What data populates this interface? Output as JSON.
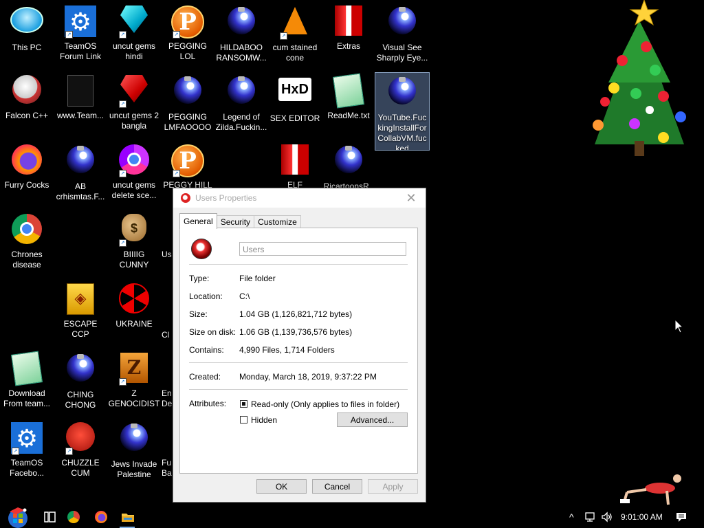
{
  "desktop": {
    "icons": [
      {
        "label": "This PC"
      },
      {
        "label": "TeamOS Forum Link"
      },
      {
        "label": "uncut gems hindi"
      },
      {
        "label": "PEGGING LOL"
      },
      {
        "label": "HILDABOO RANSOMW..."
      },
      {
        "label": "cum stained cone"
      },
      {
        "label": "Extras"
      },
      {
        "label": "Visual See Sharply Eye..."
      },
      {
        "label": "Falcon C++"
      },
      {
        "label": "www.Team..."
      },
      {
        "label": "uncut gems 2 bangla"
      },
      {
        "label": "PEGGING LMFAOOOO"
      },
      {
        "label": "Legend of Zilda.Fuckin..."
      },
      {
        "label": "SEX EDITOR"
      },
      {
        "label": "ReadMe.txt"
      },
      {
        "label": "YouTube.FuckingInstallForCollabVM.fucked"
      },
      {
        "label": "Furry Cocks"
      },
      {
        "label": "AB crhismtas.F..."
      },
      {
        "label": "uncut gems delete sce..."
      },
      {
        "label": "PEGGY HILL"
      },
      {
        "label": "ELF BOWLING"
      },
      {
        "label": "RicartoonsR..."
      },
      {
        "label": "Chrones disease"
      },
      {
        "label": "BIIIIG CUNNY"
      },
      {
        "label": "Us"
      },
      {
        "label": "ESCAPE CCP"
      },
      {
        "label": "UKRAINE"
      },
      {
        "label": "Cl"
      },
      {
        "label": "Download From team..."
      },
      {
        "label": "CHING CHONG"
      },
      {
        "label": "Z GENOCIDIST"
      },
      {
        "label": "En De"
      },
      {
        "label": "TeamOS Facebo..."
      },
      {
        "label": "CHUZZLE CUM"
      },
      {
        "label": "Jews Invade Palestine"
      },
      {
        "label": "Fu Ba"
      }
    ]
  },
  "dialog": {
    "title": "Users Properties",
    "tabs": [
      {
        "label": "General"
      },
      {
        "label": "Security"
      },
      {
        "label": "Customize"
      }
    ],
    "folder_name": "Users",
    "fields": {
      "type_label": "Type:",
      "type_value": "File folder",
      "location_label": "Location:",
      "location_value": "C:\\",
      "size_label": "Size:",
      "size_value": "1.04 GB (1,126,821,712 bytes)",
      "size_on_disk_label": "Size on disk:",
      "size_on_disk_value": "1.06 GB (1,139,736,576 bytes)",
      "contains_label": "Contains:",
      "contains_value": "4,990 Files, 1,714 Folders",
      "created_label": "Created:",
      "created_value": "Monday, March 18, 2019, 9:37:22 PM",
      "attributes_label": "Attributes:",
      "readonly_label": "Read-only (Only applies to files in folder)",
      "hidden_label": "Hidden"
    },
    "buttons": {
      "advanced": "Advanced...",
      "ok": "OK",
      "cancel": "Cancel",
      "apply": "Apply"
    }
  },
  "taskbar": {
    "clock": "9:01:00 AM",
    "icons": [
      "start-icon",
      "task-view-icon",
      "chrome-icon",
      "firefox-icon",
      "file-explorer-icon"
    ],
    "tray_icons": [
      "chevron-up-icon",
      "network-icon",
      "volume-icon",
      "notification-icon"
    ]
  }
}
